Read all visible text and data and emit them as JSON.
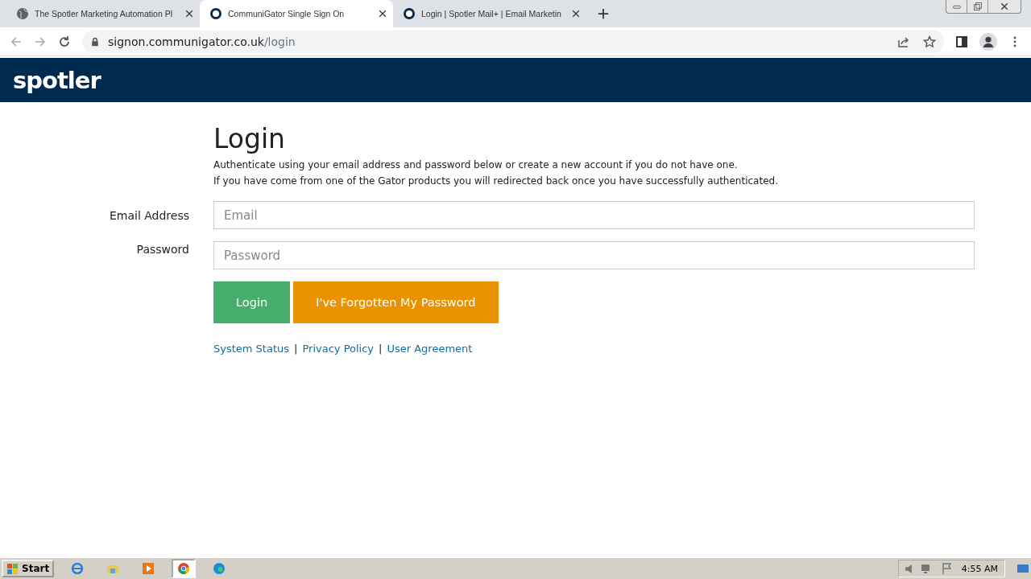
{
  "browser": {
    "tabs": [
      {
        "title": "The Spotler Marketing Automation Pl",
        "selected": false
      },
      {
        "title": "CommuniGator Single Sign On",
        "selected": true
      },
      {
        "title": "Login | Spotler Mail+ | Email Marketin",
        "selected": false
      }
    ],
    "url_host": "signon.communigator.co.uk",
    "url_path": "/login"
  },
  "header": {
    "logo": "spotler"
  },
  "login": {
    "title": "Login",
    "intro": [
      "Authenticate using your email address and password below or create a new account if you do not have one.",
      "If you have come from one of the Gator products you will redirected back once you have successfully authenticated."
    ],
    "fields": [
      {
        "label": "Email Address",
        "placeholder": "Email"
      },
      {
        "label": "Password",
        "placeholder": "Password"
      }
    ],
    "buttons": [
      {
        "label": "Login",
        "kind": "primary"
      },
      {
        "label": "I've Forgotten My Password",
        "kind": "warning"
      }
    ],
    "links": [
      "System Status",
      "Privacy Policy",
      "User Agreement"
    ],
    "separator": "|"
  },
  "taskbar": {
    "start": "Start",
    "apps": [
      {
        "kind": "ie",
        "selected": false
      },
      {
        "kind": "folder",
        "selected": false
      },
      {
        "kind": "media",
        "selected": false
      },
      {
        "kind": "chrome",
        "selected": true
      },
      {
        "kind": "edge",
        "selected": false
      }
    ],
    "clock": "4:55 AM"
  }
}
